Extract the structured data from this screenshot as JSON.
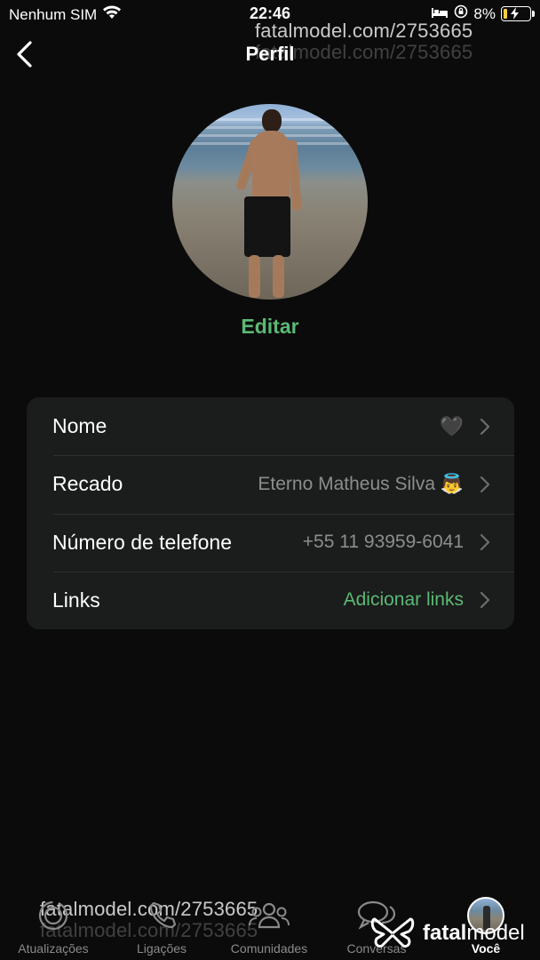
{
  "status_bar": {
    "carrier": "Nenhum SIM",
    "time": "22:46",
    "battery_percent": "8%",
    "battery_level": 0.08,
    "icons": [
      "wifi-icon",
      "bed-icon",
      "orientation-lock-icon",
      "battery-charging-icon"
    ]
  },
  "header": {
    "title": "Perfil",
    "back_icon": "chevron-left-icon"
  },
  "watermark": {
    "text": "fatalmodel.com/2753665"
  },
  "profile": {
    "edit_label": "Editar"
  },
  "fields": [
    {
      "label": "Nome",
      "value": "🖤",
      "value_style": "gray"
    },
    {
      "label": "Recado",
      "value": "Eterno Matheus Silva 👼",
      "value_style": "gray"
    },
    {
      "label": "Número de telefone",
      "value": "+55 11 93959-6041",
      "value_style": "gray"
    },
    {
      "label": "Links",
      "value": "Adicionar links",
      "value_style": "green"
    }
  ],
  "tabbar": {
    "tabs": [
      {
        "label": "Atualizações",
        "icon": "updates-icon"
      },
      {
        "label": "Ligações",
        "icon": "phone-icon"
      },
      {
        "label": "Comunidades",
        "icon": "communities-icon"
      },
      {
        "label": "Conversas",
        "icon": "chats-icon"
      },
      {
        "label": "Você",
        "icon": "profile-avatar",
        "active": true
      }
    ]
  },
  "brand": {
    "name_bold": "fatal",
    "name_regular": "model",
    "icon": "butterfly-logo-icon"
  },
  "colors": {
    "background": "#0b0b0b",
    "card": "#1b1c1c",
    "accent_green": "#5bb974",
    "secondary_text": "#8d8d8d"
  }
}
